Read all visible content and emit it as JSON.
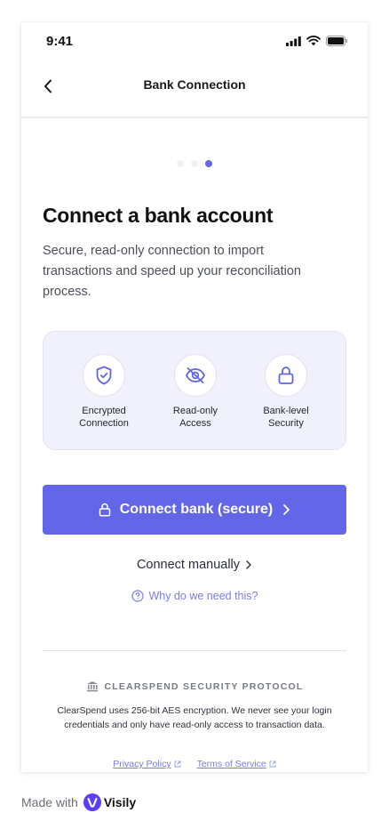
{
  "status_bar": {
    "time": "9:41"
  },
  "header": {
    "title": "Bank Connection"
  },
  "progress": {
    "step": 3,
    "total": 3
  },
  "main": {
    "heading": "Connect a bank account",
    "subtitle": "Secure, read-only connection to import transactions and speed up your reconciliation process."
  },
  "features": [
    {
      "line1": "Encrypted",
      "line2": "Connection",
      "icon": "shield-check-icon"
    },
    {
      "line1": "Read-only",
      "line2": "Access",
      "icon": "eye-off-icon"
    },
    {
      "line1": "Bank-level",
      "line2": "Security",
      "icon": "lock-icon"
    }
  ],
  "actions": {
    "connect_label": "Connect bank (secure)",
    "manual_label": "Connect manually",
    "why_label": "Why do we need this?"
  },
  "security": {
    "heading": "CLEARSPEND SECURITY PROTOCOL",
    "body": "ClearSpend uses 256-bit AES encryption. We never see your login credentials and only have read-only access to transaction data."
  },
  "footer": {
    "privacy_label": "Privacy Policy",
    "terms_label": "Terms of Service"
  },
  "made_with": {
    "label": "Made with",
    "brand": "Visily"
  },
  "colors": {
    "accent": "#6366e6",
    "card_bg": "#f1f1fd",
    "link": "#7a7ce8"
  }
}
